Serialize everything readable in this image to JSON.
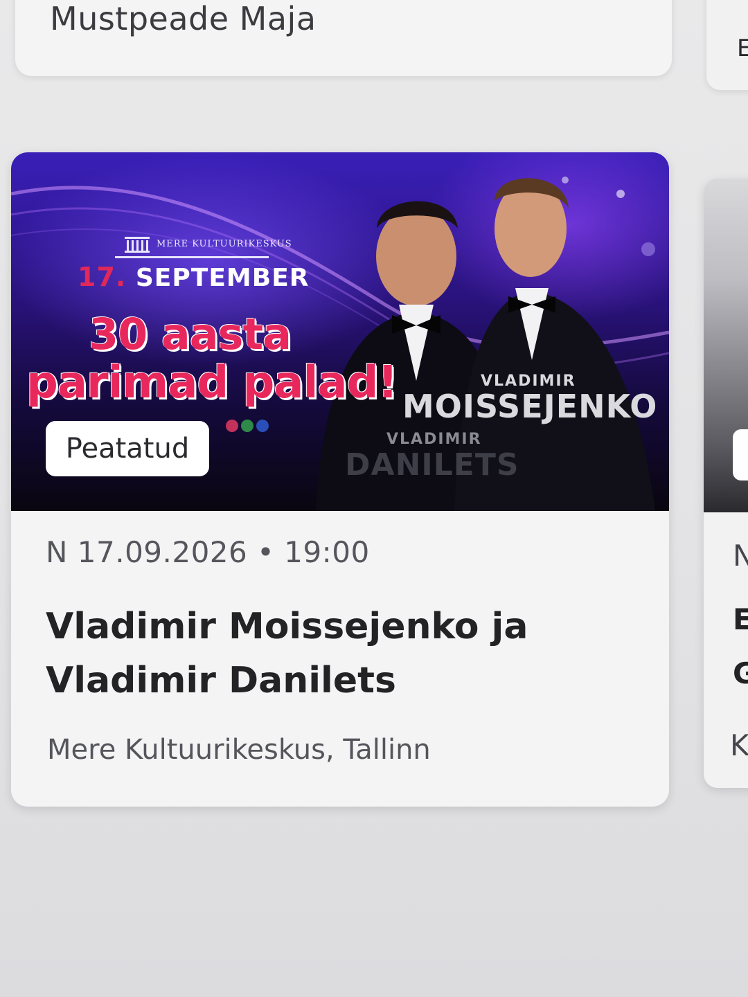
{
  "previous_event": {
    "venue": "Mustpeade Maja",
    "right_card_letter": "E"
  },
  "event": {
    "banner": {
      "venue_logo_text": "MERE KULTUURIKESKUS",
      "date_day": "17.",
      "date_month": "SEPTEMBER",
      "slogan_line1": "30 aasta",
      "slogan_line2": "parimad palad!",
      "artist1_first": "VLADIMIR",
      "artist1_last": "MOISSEJENKO",
      "artist2_first": "VLADIMIR",
      "artist2_last": "DANILETS",
      "colors": {
        "background": "#2a137e",
        "accent": "#e8285c"
      }
    },
    "status_badge": "Peatatud",
    "datetime": "N 17.09.2026 • 19:00",
    "title": "Vladimir Moissejenko ja Vladimir Danilets",
    "venue": "Mere Kultuurikeskus, Tallinn"
  },
  "next_event_partial": {
    "weekday_initial": "N",
    "title_letters": [
      "E",
      "G"
    ],
    "venue_initial": "K"
  }
}
